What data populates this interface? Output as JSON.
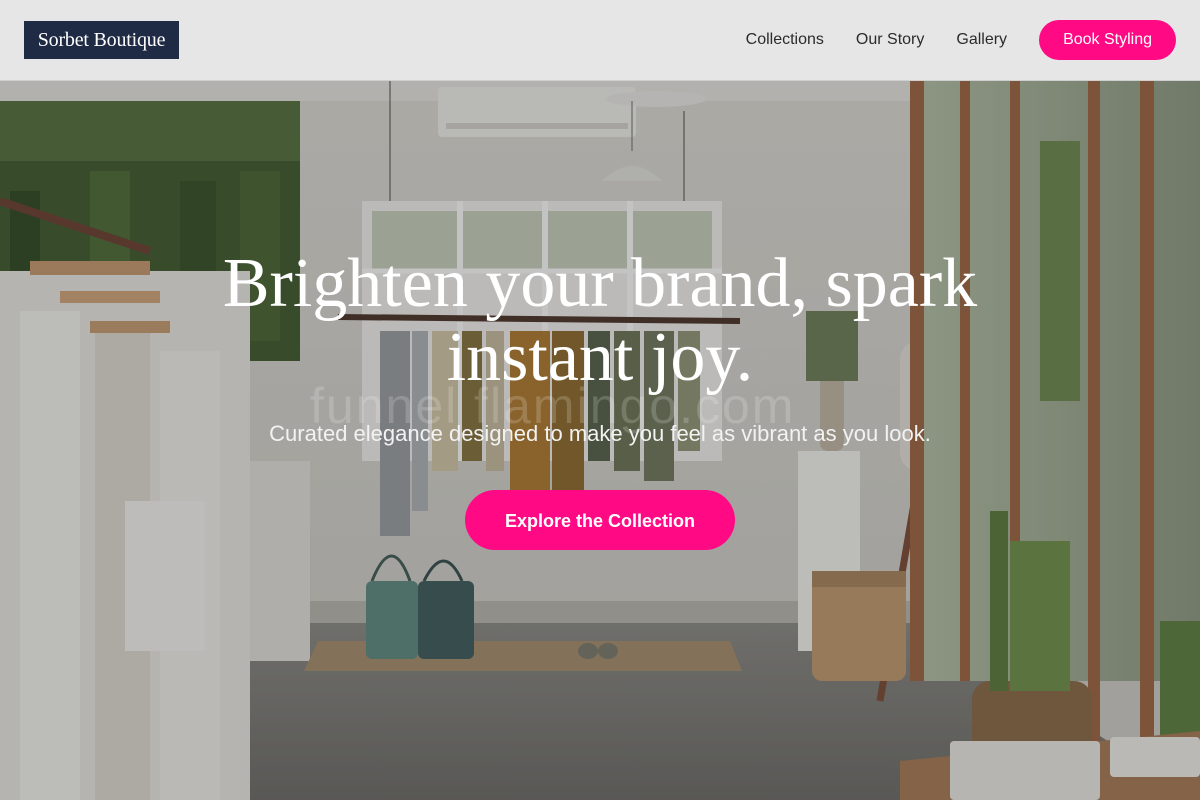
{
  "brand": {
    "name": "Sorbet Boutique"
  },
  "nav": {
    "links": [
      "Collections",
      "Our Story",
      "Gallery"
    ],
    "cta_label": "Book Styling"
  },
  "hero": {
    "headline": "Brighten your brand, spark instant joy.",
    "subtitle": "Curated elegance designed to make you feel as vibrant as you look.",
    "cta_label": "Explore the Collection",
    "watermark": "funnel flamingo.com"
  },
  "colors": {
    "accent": "#ff0a84",
    "logo_background": "#1f2a44",
    "nav_background": "#e6e6e6"
  }
}
